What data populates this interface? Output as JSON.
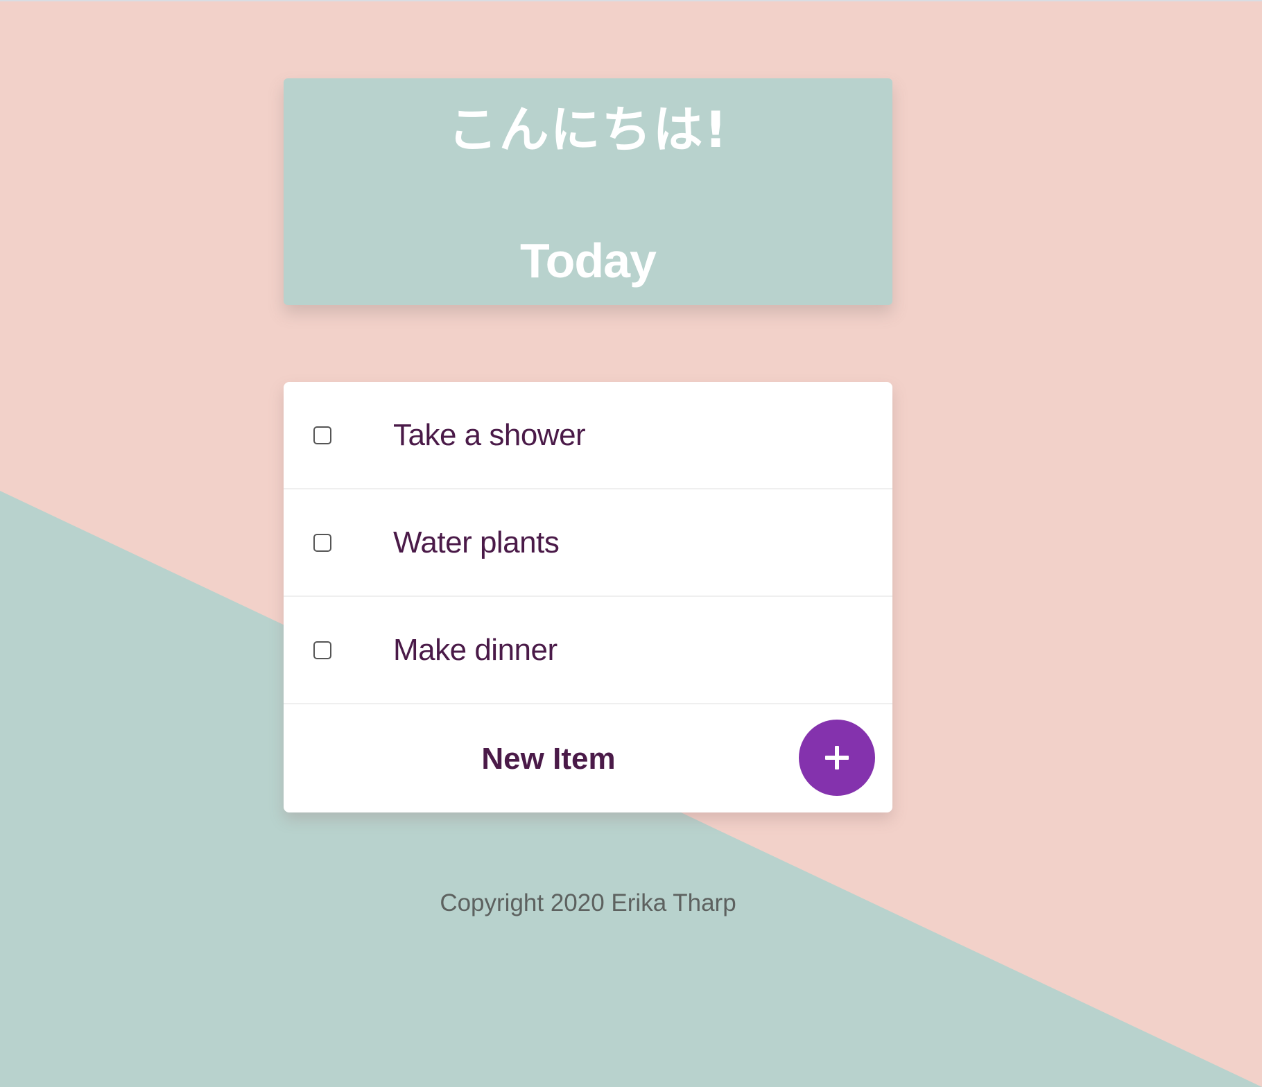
{
  "header": {
    "greeting": "こんにちは!",
    "title": "Today"
  },
  "todos": [
    {
      "label": "Take a shower",
      "checked": false
    },
    {
      "label": "Water plants",
      "checked": false
    },
    {
      "label": "Make dinner",
      "checked": false
    }
  ],
  "new_item": {
    "placeholder": "New Item",
    "add_icon": "plus-icon"
  },
  "footer": {
    "copyright": "Copyright 2020 Erika Tharp"
  },
  "colors": {
    "background_pink": "#f2d1c9",
    "background_teal": "#b8d2cd",
    "header_card": "#b8d2cd",
    "text_purple": "#4a1a48",
    "accent_purple": "#8432ad",
    "footer_text": "#5d615f"
  }
}
